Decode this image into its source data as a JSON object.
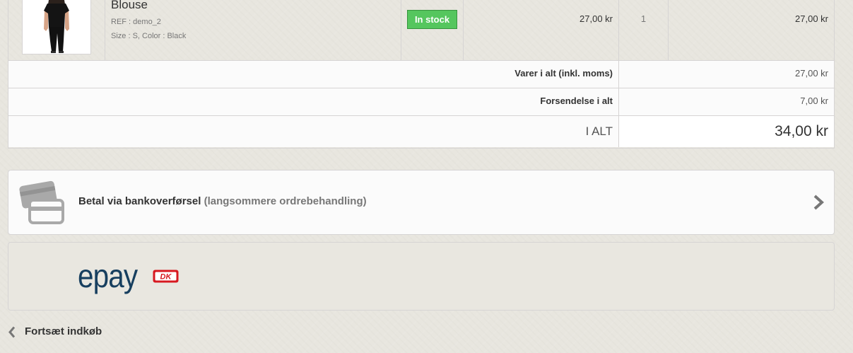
{
  "cart": {
    "product": {
      "name": "Blouse",
      "reference": "REF : demo_2",
      "attributes": "Size : S, Color : Black",
      "availability": "In stock",
      "unit_price": "27,00 kr",
      "quantity": "1",
      "total_price": "27,00 kr"
    },
    "summary": [
      {
        "label": "Varer i alt (inkl. moms)",
        "value": "27,00 kr"
      },
      {
        "label": "Forsendelse i alt",
        "value": "7,00 kr"
      },
      {
        "label": "I ALT",
        "value": "34,00 kr"
      }
    ]
  },
  "payment": {
    "bank_transfer": {
      "label": "Betal via bankoverførsel",
      "note": "(langsommere ordrebehandling)",
      "icon": "credit-cards-icon",
      "arrow_icon": "chevron-right-icon"
    },
    "epay": {
      "logo_text": "epay",
      "card_logo_text": "DK"
    }
  },
  "navigation": {
    "continue_shopping": "Fortsæt indkøb",
    "continue_icon": "chevron-left-icon"
  },
  "colors": {
    "page_background": "#e8e6df",
    "border": "#d6d4d4",
    "in_stock_badge": "#55c65e",
    "epay_brand": "#173f5f",
    "dankort_red": "#d71920"
  }
}
